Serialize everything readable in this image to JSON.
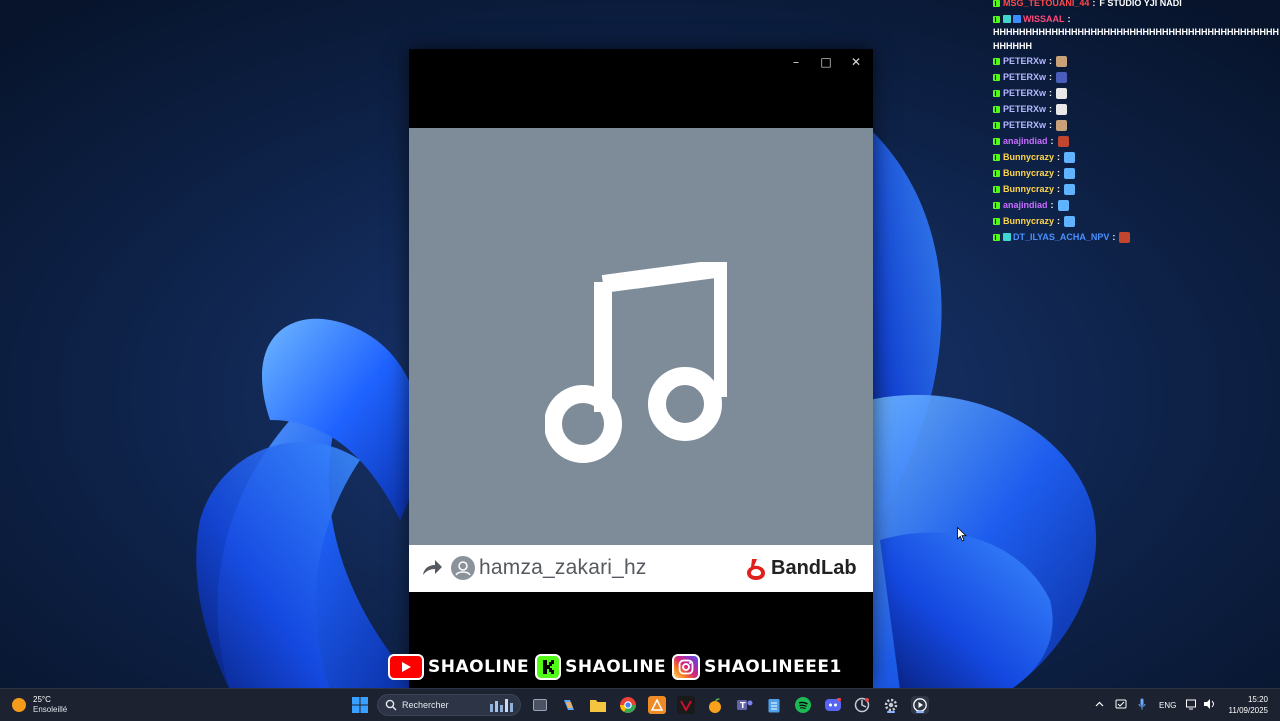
{
  "window": {
    "minimize_glyph": "–",
    "maximize_glyph": "□",
    "close_glyph": "✕"
  },
  "player": {
    "artwork_icon": "music-note-icon",
    "artwork_bg": "#7e8b98",
    "username": "hamza_zakari_hz",
    "brand": "BandLab",
    "brand_color": "#e0201b"
  },
  "chat": {
    "lines": [
      {
        "user": "MSG_TETOUANI_44",
        "color": "#ff4a4a",
        "message": "F STUDIO YJI NADI",
        "emote": "",
        "badges": [
          "kick"
        ]
      },
      {
        "user": "WISSAAL",
        "color": "#ff4a7a",
        "message": "HHHHHHHHHHHHHHHHHHHHHHHHHHHHHHHHHHHHHHHHHHHHHHHHHH",
        "emote": "",
        "badges": [
          "kick",
          "sub",
          "vip"
        ]
      },
      {
        "user": "PETERXw",
        "color": "#b5b9ff",
        "message": "",
        "emote": "emote-face",
        "badges": [
          "kick"
        ]
      },
      {
        "user": "PETERXw",
        "color": "#b5b9ff",
        "message": "",
        "emote": "emote-man",
        "badges": [
          "kick"
        ]
      },
      {
        "user": "PETERXw",
        "color": "#b5b9ff",
        "message": "",
        "emote": "emote-ghost",
        "badges": [
          "kick"
        ]
      },
      {
        "user": "PETERXw",
        "color": "#b5b9ff",
        "message": "",
        "emote": "emote-ghost",
        "badges": [
          "kick"
        ]
      },
      {
        "user": "PETERXw",
        "color": "#b5b9ff",
        "message": "",
        "emote": "emote-face",
        "badges": [
          "kick"
        ]
      },
      {
        "user": "anajindiad",
        "color": "#c86dff",
        "message": "",
        "emote": "emote-red",
        "badges": [
          "kick"
        ]
      },
      {
        "user": "Bunnycrazy",
        "color": "#ffd64a",
        "message": "",
        "emote": "emote-bird",
        "badges": [
          "kick"
        ]
      },
      {
        "user": "Bunnycrazy",
        "color": "#ffd64a",
        "message": "",
        "emote": "emote-bird",
        "badges": [
          "kick"
        ]
      },
      {
        "user": "Bunnycrazy",
        "color": "#ffd64a",
        "message": "",
        "emote": "emote-bird",
        "badges": [
          "kick"
        ]
      },
      {
        "user": "anajindiad",
        "color": "#c86dff",
        "message": "",
        "emote": "emote-bird",
        "badges": [
          "kick"
        ]
      },
      {
        "user": "Bunnycrazy",
        "color": "#ffd64a",
        "message": "",
        "emote": "emote-bird",
        "badges": [
          "kick"
        ]
      },
      {
        "user": "DT_ILYAS_ACHA_NPV",
        "color": "#4a90ff",
        "message": "",
        "emote": "emote-red",
        "badges": [
          "kick",
          "sub"
        ]
      }
    ]
  },
  "social": [
    {
      "platform": "youtube",
      "icon": "youtube-icon",
      "label": "SHAOLINE",
      "color": "#ff0000"
    },
    {
      "platform": "kick",
      "icon": "kick-icon",
      "label": "SHAOLINE",
      "color": "#53fc18"
    },
    {
      "platform": "instagram",
      "icon": "instagram-icon",
      "label": "SHAOLINEEE1",
      "color": "#d62976"
    }
  ],
  "taskbar": {
    "weather_temp": "25°C",
    "weather_desc": "Ensoleillé",
    "search_placeholder": "Rechercher",
    "language": "ENG",
    "time": "15:20",
    "date": "11/09/2025",
    "apps": [
      {
        "name": "start-button",
        "icon": "windows-icon",
        "color": "#3aa0ff"
      },
      {
        "name": "task-view-button",
        "icon": "task-view-icon",
        "color": "#9aa4b5"
      },
      {
        "name": "copilot-button",
        "icon": "copilot-icon",
        "color": "#5fa8ff"
      },
      {
        "name": "file-explorer-button",
        "icon": "folder-icon",
        "color": "#f5c542"
      },
      {
        "name": "chrome-button",
        "icon": "chrome-icon",
        "color": "#34a853"
      },
      {
        "name": "app-orange-button",
        "icon": "triangle-app-icon",
        "color": "#f08a24"
      },
      {
        "name": "app-red-button",
        "icon": "v-app-icon",
        "color": "#c8102e"
      },
      {
        "name": "fl-studio-button",
        "icon": "fruit-icon",
        "color": "#f6a21c"
      },
      {
        "name": "teams-button",
        "icon": "teams-icon",
        "color": "#6264a7"
      },
      {
        "name": "notepad-button",
        "icon": "notepad-icon",
        "color": "#4ea0e8"
      },
      {
        "name": "spotify-button",
        "icon": "spotify-icon",
        "color": "#1db954"
      },
      {
        "name": "discord-button",
        "icon": "discord-icon",
        "color": "#5865f2"
      },
      {
        "name": "app-gray-button",
        "icon": "circle-app-icon",
        "color": "#8a8f99"
      },
      {
        "name": "settings-button",
        "icon": "gear-icon",
        "color": "#9aa4b5"
      },
      {
        "name": "media-player-button",
        "icon": "play-icon",
        "color": "#ffffff"
      }
    ]
  }
}
